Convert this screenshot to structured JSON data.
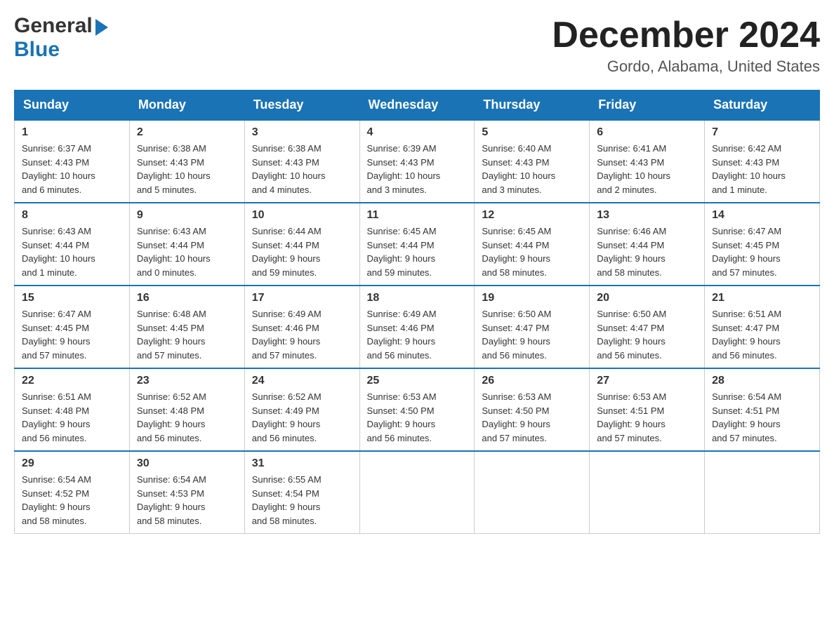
{
  "logo": {
    "line1": "General",
    "triangle": "▶",
    "line2": "Blue"
  },
  "header": {
    "month": "December 2024",
    "location": "Gordo, Alabama, United States"
  },
  "days_of_week": [
    "Sunday",
    "Monday",
    "Tuesday",
    "Wednesday",
    "Thursday",
    "Friday",
    "Saturday"
  ],
  "weeks": [
    [
      {
        "day": "1",
        "sunrise": "6:37 AM",
        "sunset": "4:43 PM",
        "daylight": "10 hours and 6 minutes."
      },
      {
        "day": "2",
        "sunrise": "6:38 AM",
        "sunset": "4:43 PM",
        "daylight": "10 hours and 5 minutes."
      },
      {
        "day": "3",
        "sunrise": "6:38 AM",
        "sunset": "4:43 PM",
        "daylight": "10 hours and 4 minutes."
      },
      {
        "day": "4",
        "sunrise": "6:39 AM",
        "sunset": "4:43 PM",
        "daylight": "10 hours and 3 minutes."
      },
      {
        "day": "5",
        "sunrise": "6:40 AM",
        "sunset": "4:43 PM",
        "daylight": "10 hours and 3 minutes."
      },
      {
        "day": "6",
        "sunrise": "6:41 AM",
        "sunset": "4:43 PM",
        "daylight": "10 hours and 2 minutes."
      },
      {
        "day": "7",
        "sunrise": "6:42 AM",
        "sunset": "4:43 PM",
        "daylight": "10 hours and 1 minute."
      }
    ],
    [
      {
        "day": "8",
        "sunrise": "6:43 AM",
        "sunset": "4:44 PM",
        "daylight": "10 hours and 1 minute."
      },
      {
        "day": "9",
        "sunrise": "6:43 AM",
        "sunset": "4:44 PM",
        "daylight": "10 hours and 0 minutes."
      },
      {
        "day": "10",
        "sunrise": "6:44 AM",
        "sunset": "4:44 PM",
        "daylight": "9 hours and 59 minutes."
      },
      {
        "day": "11",
        "sunrise": "6:45 AM",
        "sunset": "4:44 PM",
        "daylight": "9 hours and 59 minutes."
      },
      {
        "day": "12",
        "sunrise": "6:45 AM",
        "sunset": "4:44 PM",
        "daylight": "9 hours and 58 minutes."
      },
      {
        "day": "13",
        "sunrise": "6:46 AM",
        "sunset": "4:44 PM",
        "daylight": "9 hours and 58 minutes."
      },
      {
        "day": "14",
        "sunrise": "6:47 AM",
        "sunset": "4:45 PM",
        "daylight": "9 hours and 57 minutes."
      }
    ],
    [
      {
        "day": "15",
        "sunrise": "6:47 AM",
        "sunset": "4:45 PM",
        "daylight": "9 hours and 57 minutes."
      },
      {
        "day": "16",
        "sunrise": "6:48 AM",
        "sunset": "4:45 PM",
        "daylight": "9 hours and 57 minutes."
      },
      {
        "day": "17",
        "sunrise": "6:49 AM",
        "sunset": "4:46 PM",
        "daylight": "9 hours and 57 minutes."
      },
      {
        "day": "18",
        "sunrise": "6:49 AM",
        "sunset": "4:46 PM",
        "daylight": "9 hours and 56 minutes."
      },
      {
        "day": "19",
        "sunrise": "6:50 AM",
        "sunset": "4:47 PM",
        "daylight": "9 hours and 56 minutes."
      },
      {
        "day": "20",
        "sunrise": "6:50 AM",
        "sunset": "4:47 PM",
        "daylight": "9 hours and 56 minutes."
      },
      {
        "day": "21",
        "sunrise": "6:51 AM",
        "sunset": "4:47 PM",
        "daylight": "9 hours and 56 minutes."
      }
    ],
    [
      {
        "day": "22",
        "sunrise": "6:51 AM",
        "sunset": "4:48 PM",
        "daylight": "9 hours and 56 minutes."
      },
      {
        "day": "23",
        "sunrise": "6:52 AM",
        "sunset": "4:48 PM",
        "daylight": "9 hours and 56 minutes."
      },
      {
        "day": "24",
        "sunrise": "6:52 AM",
        "sunset": "4:49 PM",
        "daylight": "9 hours and 56 minutes."
      },
      {
        "day": "25",
        "sunrise": "6:53 AM",
        "sunset": "4:50 PM",
        "daylight": "9 hours and 56 minutes."
      },
      {
        "day": "26",
        "sunrise": "6:53 AM",
        "sunset": "4:50 PM",
        "daylight": "9 hours and 57 minutes."
      },
      {
        "day": "27",
        "sunrise": "6:53 AM",
        "sunset": "4:51 PM",
        "daylight": "9 hours and 57 minutes."
      },
      {
        "day": "28",
        "sunrise": "6:54 AM",
        "sunset": "4:51 PM",
        "daylight": "9 hours and 57 minutes."
      }
    ],
    [
      {
        "day": "29",
        "sunrise": "6:54 AM",
        "sunset": "4:52 PM",
        "daylight": "9 hours and 58 minutes."
      },
      {
        "day": "30",
        "sunrise": "6:54 AM",
        "sunset": "4:53 PM",
        "daylight": "9 hours and 58 minutes."
      },
      {
        "day": "31",
        "sunrise": "6:55 AM",
        "sunset": "4:54 PM",
        "daylight": "9 hours and 58 minutes."
      },
      null,
      null,
      null,
      null
    ]
  ],
  "labels": {
    "sunrise": "Sunrise:",
    "sunset": "Sunset:",
    "daylight": "Daylight:"
  }
}
